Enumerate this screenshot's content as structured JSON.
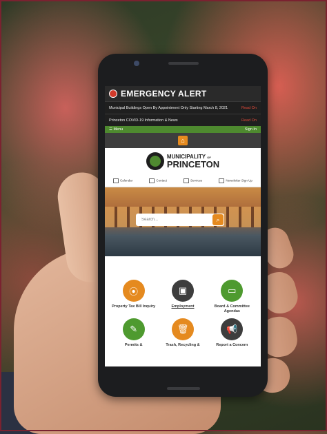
{
  "alert": {
    "title": "EMERGENCY ALERT"
  },
  "news": [
    {
      "text": "Municipal Buildings Open By Appointment Only Starting March 8, 2021",
      "more": "Read On"
    },
    {
      "text": "Princeton COVID-19 Information & News",
      "more": "Read On"
    }
  ],
  "menubar": {
    "menu": "Menu",
    "signin": "Sign In"
  },
  "logo": {
    "line1": "MUNICIPALITY",
    "of": "OF",
    "line2": "PRINCETON"
  },
  "quick": [
    "Calendar",
    "Contact",
    "Services",
    "Newsletter Sign Up"
  ],
  "search": {
    "placeholder": "Search..."
  },
  "tiles": [
    {
      "label": "Property Tax Bill Inquiry",
      "color": "#e58a1f",
      "icon": "location-pin-icon"
    },
    {
      "label": "Employment",
      "color": "#3d3d3d",
      "icon": "briefcase-icon"
    },
    {
      "label": "Board & Committee Agendas",
      "color": "#4e9a2f",
      "icon": "folder-icon"
    },
    {
      "label": "Permits &",
      "color": "#4e9a2f",
      "icon": "edit-icon"
    },
    {
      "label": "Trash, Recycling &",
      "color": "#e58a1f",
      "icon": "trash-icon"
    },
    {
      "label": "Report a Concern",
      "color": "#3d3d3d",
      "icon": "megaphone-icon"
    }
  ]
}
